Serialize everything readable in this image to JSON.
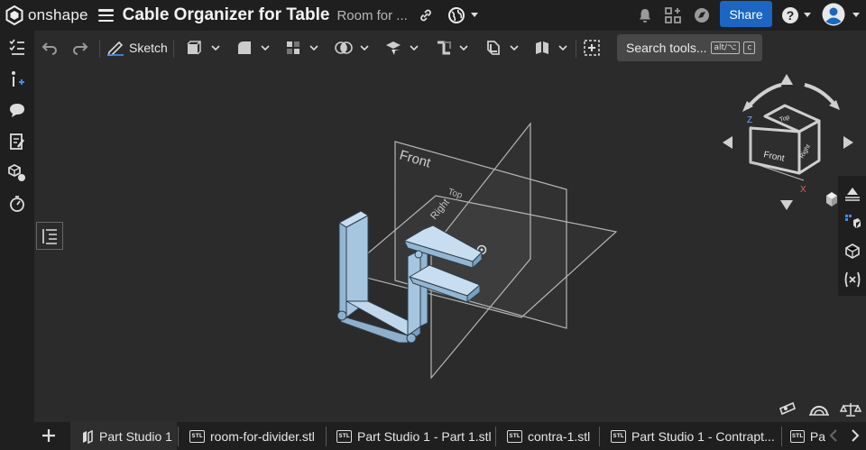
{
  "app": {
    "brand": "onshape",
    "document_title": "Cable Organizer for Table",
    "document_subtitle": "Room for ...",
    "share_label": "Share"
  },
  "toolbar": {
    "sketch_label": "Sketch",
    "search_label": "Search tools...",
    "search_shortcut_1": "alt/⌥",
    "search_shortcut_2": "c"
  },
  "viewport": {
    "plane_front_label": "Front",
    "plane_right_label": "Right",
    "plane_top_label": "Top",
    "cube_front": "Front",
    "cube_top": "Top",
    "cube_right": "Right",
    "axis_z": "Z",
    "axis_x": "X"
  },
  "tabs": [
    {
      "label": "Part Studio 1",
      "icon": "part-studio-icon",
      "active": true
    },
    {
      "label": "room-for-divider.stl",
      "icon": "stl-icon"
    },
    {
      "label": "Part Studio 1 - Part 1.stl",
      "icon": "stl-icon"
    },
    {
      "label": "contra-1.stl",
      "icon": "stl-icon"
    },
    {
      "label": "Part Studio 1 - Contrapt...",
      "icon": "stl-icon"
    },
    {
      "label": "Pa",
      "icon": "stl-icon"
    }
  ],
  "stl_badge": "STL",
  "colors": {
    "background": "#2b2b2b",
    "chrome": "#1f1f1f",
    "accent": "#1a66c2",
    "part": "#a9c9e3"
  }
}
